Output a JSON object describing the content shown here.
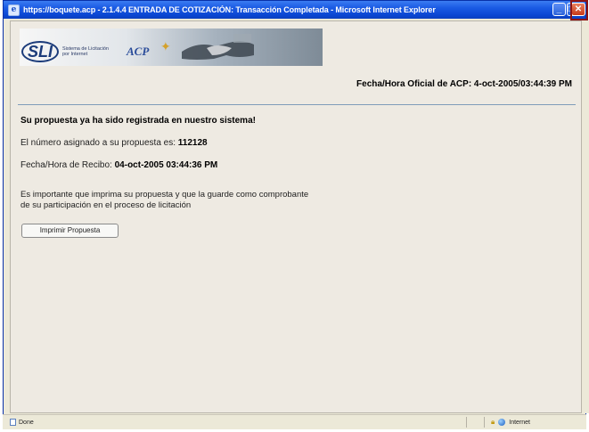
{
  "window": {
    "title": "https://boquete.acp - 2.1.4.4 ENTRADA DE COTIZACIÓN: Transacción Completada - Microsoft Internet Explorer",
    "buttons": {
      "minimize": "_",
      "maximize": "□",
      "close": "✕"
    }
  },
  "banner": {
    "logo_text": "SLI",
    "logo_subtitle": "Sistema de Licitación por Internet",
    "acp_text": "ACP"
  },
  "header": {
    "official_time": "Fecha/Hora Oficial de ACP: 4-oct-2005/03:44:39 PM"
  },
  "main": {
    "confirmation": "Su propuesta ya ha sido registrada en nuestro sistema!",
    "number_label": "El número asignado a su propuesta es:",
    "number_value": "112128",
    "receipt_label": "Fecha/Hora de Recibo:",
    "receipt_value": "04-oct-2005 03:44:36 PM",
    "note_line1": "Es importante que imprima su propuesta y que la guarde como comprobante",
    "note_line2": "de su participación en el proceso de licitación",
    "print_button": "Imprimir Propuesta"
  },
  "statusbar": {
    "status": "Done",
    "zone": "Internet"
  }
}
